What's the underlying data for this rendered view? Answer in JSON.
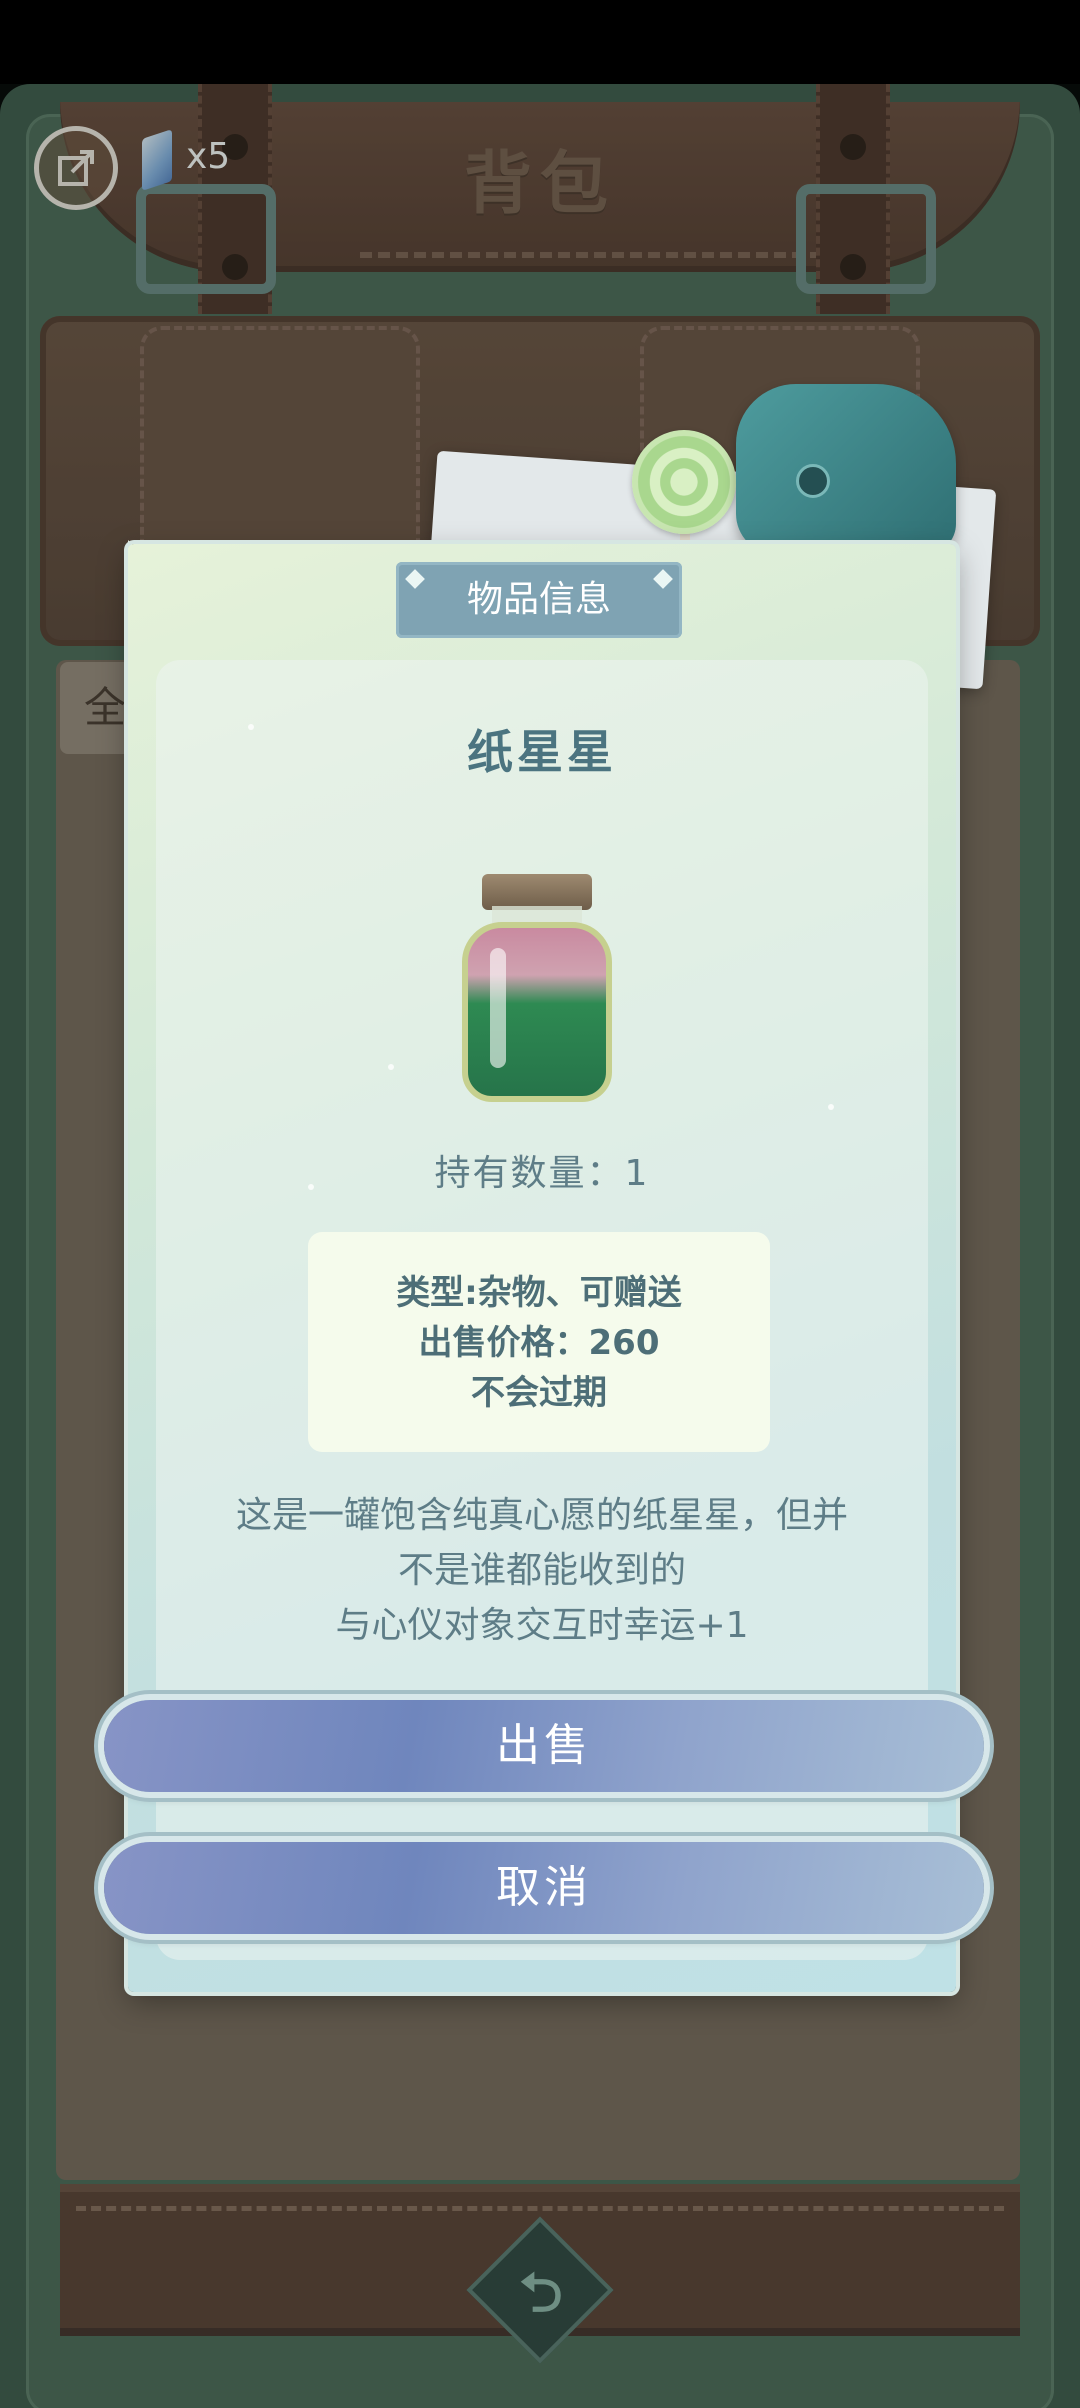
{
  "header": {
    "title": "背包",
    "exit_icon": "exit-icon",
    "currency_icon": "crystal-icon",
    "currency_count": "x5"
  },
  "background": {
    "tab_label": "全"
  },
  "modal": {
    "header_label": "物品信息",
    "item_name": "纸星星",
    "item_icon": "star-jar-icon",
    "count_text": "持有数量：1",
    "info": {
      "type_line": "类型:杂物、可赠送",
      "price_line": "出售价格：260",
      "expiry_line": "不会过期"
    },
    "description_lines": [
      "这是一罐饱含纯真心愿的纸星星，但并",
      "不是谁都能收到的",
      "与心仪对象交互时幸运+1"
    ],
    "sell_label": "出售",
    "cancel_label": "取消"
  },
  "footer": {
    "back_icon": "back-icon"
  },
  "colors": {
    "frame": "#3f5a4b",
    "leather": "#6b4b3d",
    "modal_text": "#4b7480",
    "button": "#7f8ec4"
  }
}
